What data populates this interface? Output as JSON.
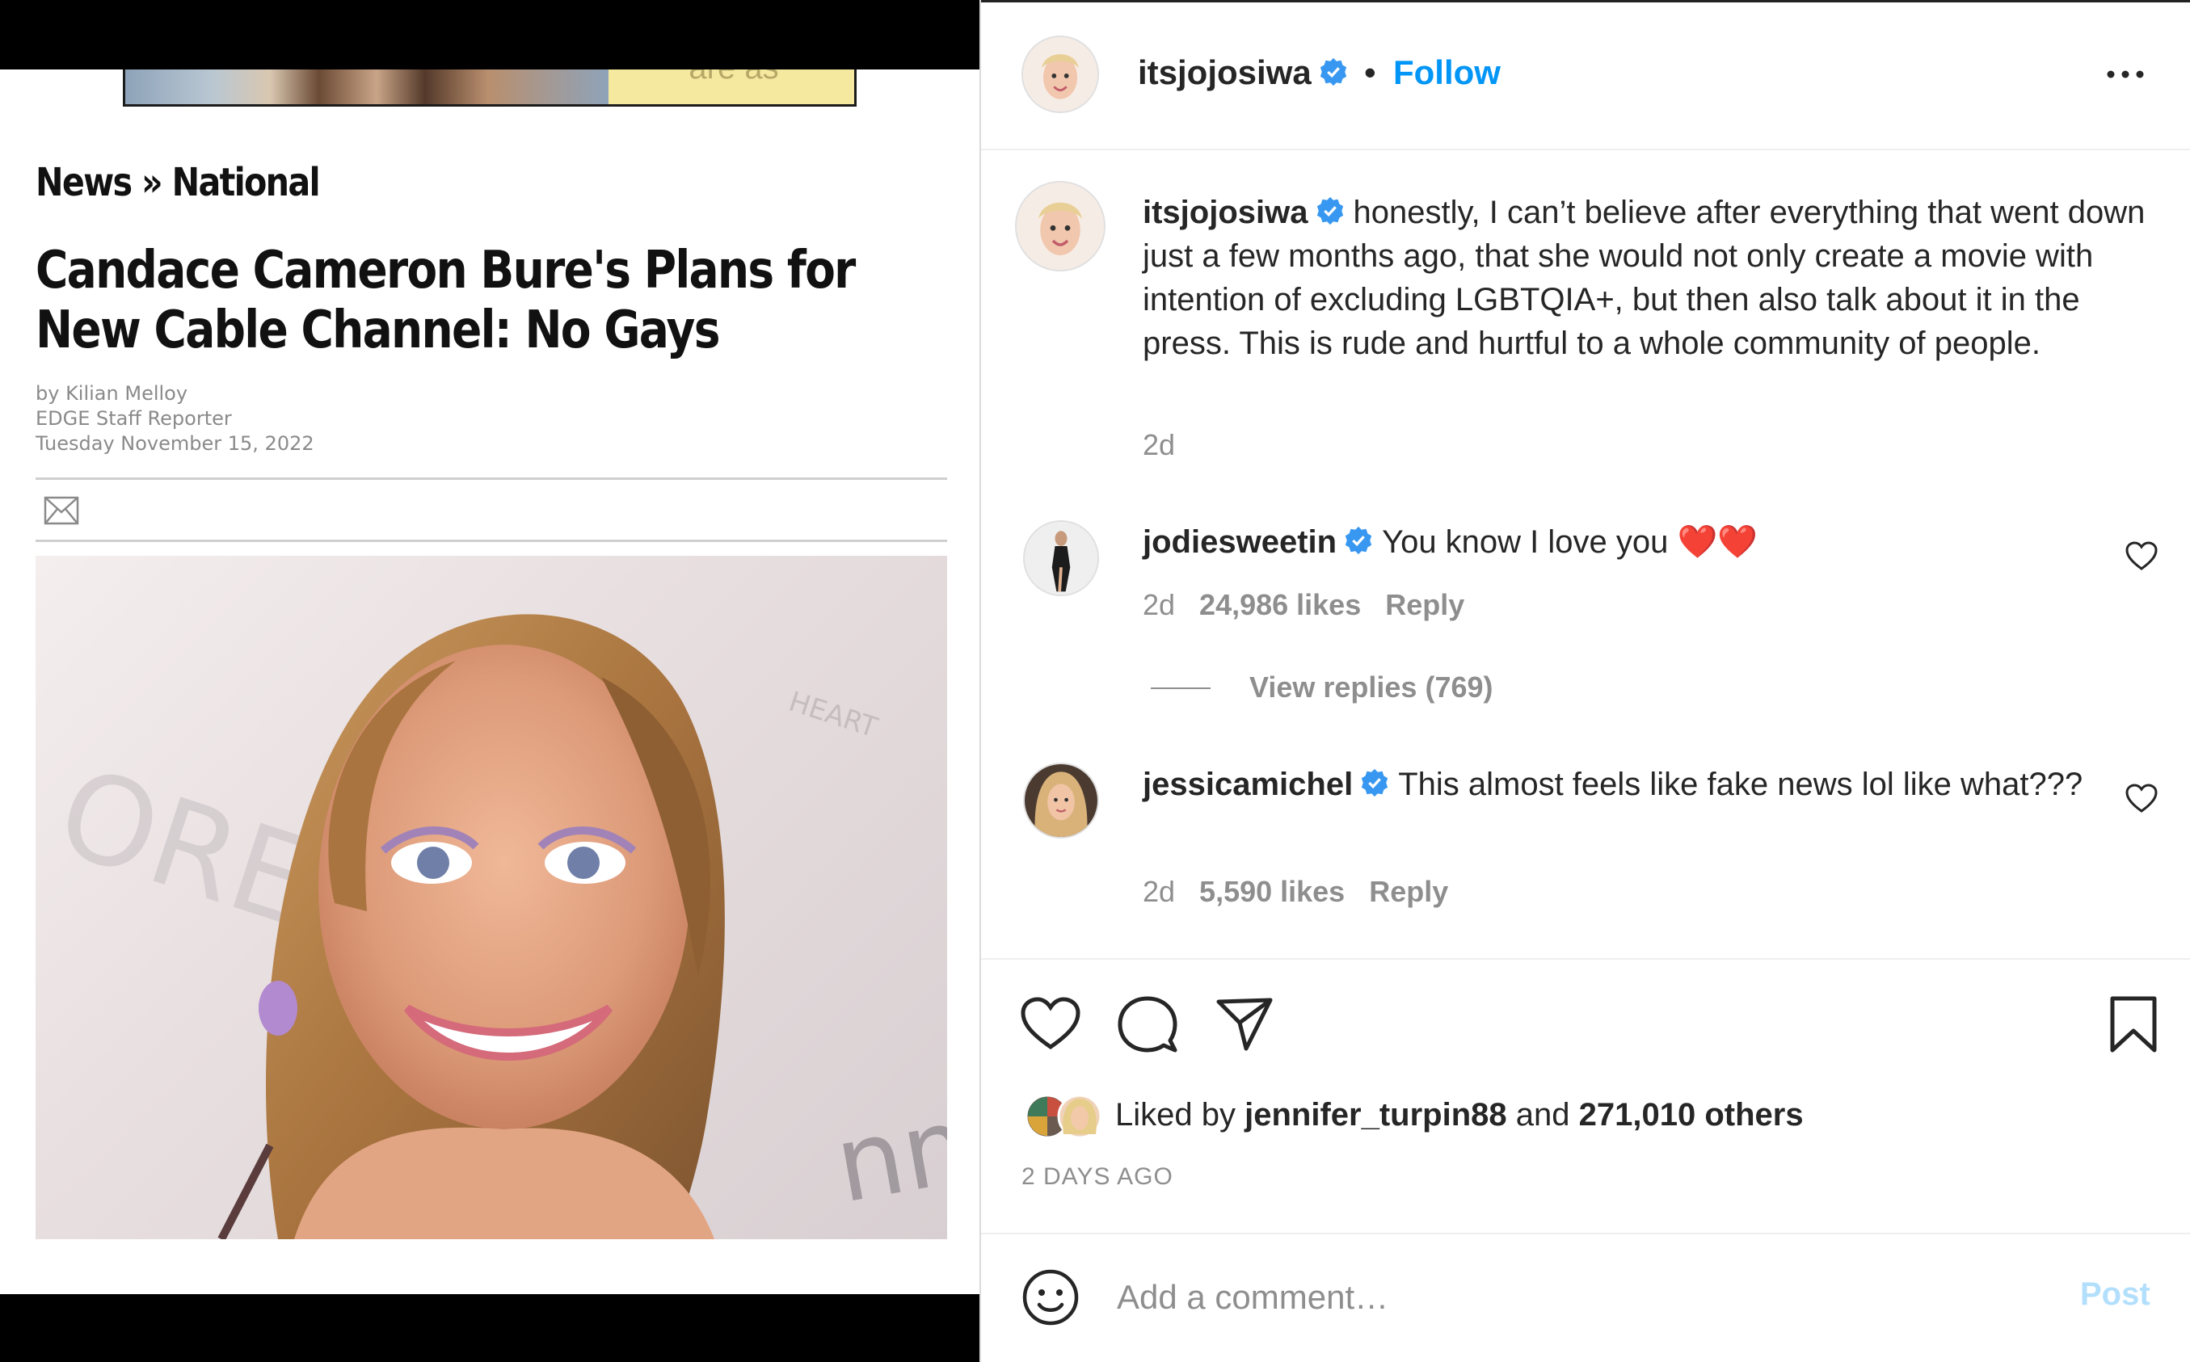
{
  "article": {
    "ad_text": "are as",
    "breadcrumb": "News » National",
    "headline": "Candace Cameron Bure's Plans for New Cable Channel: No Gays",
    "byline": [
      "by Kilian Melloy",
      "EDGE Staff Reporter",
      "Tuesday November 15, 2022"
    ],
    "photo_text": [
      "OREAL",
      "HEART",
      "nme"
    ],
    "icons": {
      "share": "mail-icon"
    }
  },
  "post": {
    "author": "itsjojosiwa",
    "separator": "•",
    "follow_label": "Follow",
    "caption": {
      "username": "itsjojosiwa",
      "text": "honestly, I can’t believe after everything that went down just a few months ago, that she would not only create a movie with intention of excluding LGBTQIA+, but then also talk about it in the press. This is rude and hurtful to a whole community of people.",
      "time": "2d"
    },
    "comments": [
      {
        "username": "jodiesweetin",
        "text": "You know I love you ❤️❤️",
        "time": "2d",
        "likes": "24,986 likes",
        "reply_label": "Reply",
        "view_replies": "View replies (769)"
      },
      {
        "username": "jessicamichel",
        "text": "This almost feels like fake news lol like what???",
        "time": "2d",
        "likes": "5,590 likes",
        "reply_label": "Reply"
      }
    ],
    "liked_by_prefix": "Liked by",
    "liked_by_user": "jennifer_turpin88",
    "liked_by_and": "and",
    "liked_by_others": "271,010 others",
    "timestamp": "2 DAYS AGO",
    "comment_placeholder": "Add a comment…",
    "post_label": "Post",
    "icons": {
      "verified": "verified-badge-icon",
      "more": "more-options-icon",
      "like": "heart-icon",
      "comment": "comment-icon",
      "share": "send-icon",
      "save": "bookmark-icon",
      "emoji": "emoji-icon"
    },
    "colors": {
      "link": "#0095f6",
      "verified": "#3897f0",
      "muted": "#8e8e8e",
      "post_disabled": "#b2dffc"
    }
  }
}
